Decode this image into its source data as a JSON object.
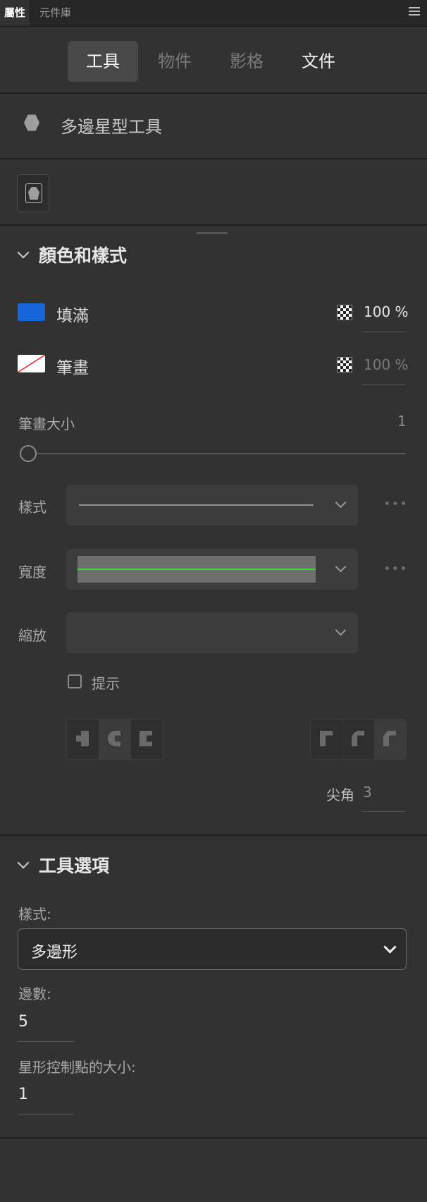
{
  "panel_tabs": [
    "屬性",
    "元件庫"
  ],
  "header_tabs": [
    "工具",
    "物件",
    "影格",
    "文件"
  ],
  "tool": {
    "name": "多邊星型工具"
  },
  "color_style": {
    "title": "顏色和樣式",
    "fill": {
      "label": "填滿",
      "opacity": "100 %",
      "color": "#1565d8"
    },
    "stroke": {
      "label": "筆畫",
      "opacity": "100 %"
    },
    "stroke_size": {
      "label": "筆畫大小",
      "value": "1"
    },
    "style_label": "樣式",
    "width_label": "寬度",
    "scale_label": "縮放",
    "hint_label": "提示",
    "miter": {
      "label": "尖角",
      "value": "3"
    }
  },
  "tool_options": {
    "title": "工具選項",
    "style_label": "樣式:",
    "style_value": "多邊形",
    "sides_label": "邊數:",
    "sides_value": "5",
    "star_point_label": "星形控制點的大小:",
    "star_point_value": "1"
  }
}
